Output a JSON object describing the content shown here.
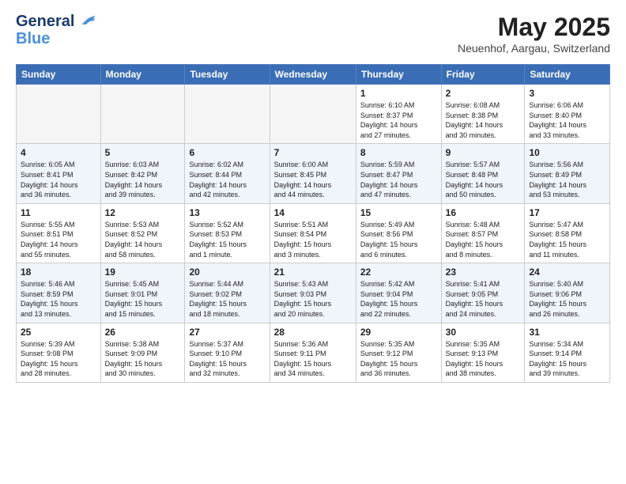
{
  "header": {
    "logo_line1": "General",
    "logo_line2": "Blue",
    "month": "May 2025",
    "location": "Neuenhof, Aargau, Switzerland"
  },
  "weekdays": [
    "Sunday",
    "Monday",
    "Tuesday",
    "Wednesday",
    "Thursday",
    "Friday",
    "Saturday"
  ],
  "weeks": [
    [
      {
        "day": "",
        "info": ""
      },
      {
        "day": "",
        "info": ""
      },
      {
        "day": "",
        "info": ""
      },
      {
        "day": "",
        "info": ""
      },
      {
        "day": "1",
        "info": "Sunrise: 6:10 AM\nSunset: 8:37 PM\nDaylight: 14 hours\nand 27 minutes."
      },
      {
        "day": "2",
        "info": "Sunrise: 6:08 AM\nSunset: 8:38 PM\nDaylight: 14 hours\nand 30 minutes."
      },
      {
        "day": "3",
        "info": "Sunrise: 6:06 AM\nSunset: 8:40 PM\nDaylight: 14 hours\nand 33 minutes."
      }
    ],
    [
      {
        "day": "4",
        "info": "Sunrise: 6:05 AM\nSunset: 8:41 PM\nDaylight: 14 hours\nand 36 minutes."
      },
      {
        "day": "5",
        "info": "Sunrise: 6:03 AM\nSunset: 8:42 PM\nDaylight: 14 hours\nand 39 minutes."
      },
      {
        "day": "6",
        "info": "Sunrise: 6:02 AM\nSunset: 8:44 PM\nDaylight: 14 hours\nand 42 minutes."
      },
      {
        "day": "7",
        "info": "Sunrise: 6:00 AM\nSunset: 8:45 PM\nDaylight: 14 hours\nand 44 minutes."
      },
      {
        "day": "8",
        "info": "Sunrise: 5:59 AM\nSunset: 8:47 PM\nDaylight: 14 hours\nand 47 minutes."
      },
      {
        "day": "9",
        "info": "Sunrise: 5:57 AM\nSunset: 8:48 PM\nDaylight: 14 hours\nand 50 minutes."
      },
      {
        "day": "10",
        "info": "Sunrise: 5:56 AM\nSunset: 8:49 PM\nDaylight: 14 hours\nand 53 minutes."
      }
    ],
    [
      {
        "day": "11",
        "info": "Sunrise: 5:55 AM\nSunset: 8:51 PM\nDaylight: 14 hours\nand 55 minutes."
      },
      {
        "day": "12",
        "info": "Sunrise: 5:53 AM\nSunset: 8:52 PM\nDaylight: 14 hours\nand 58 minutes."
      },
      {
        "day": "13",
        "info": "Sunrise: 5:52 AM\nSunset: 8:53 PM\nDaylight: 15 hours\nand 1 minute."
      },
      {
        "day": "14",
        "info": "Sunrise: 5:51 AM\nSunset: 8:54 PM\nDaylight: 15 hours\nand 3 minutes."
      },
      {
        "day": "15",
        "info": "Sunrise: 5:49 AM\nSunset: 8:56 PM\nDaylight: 15 hours\nand 6 minutes."
      },
      {
        "day": "16",
        "info": "Sunrise: 5:48 AM\nSunset: 8:57 PM\nDaylight: 15 hours\nand 8 minutes."
      },
      {
        "day": "17",
        "info": "Sunrise: 5:47 AM\nSunset: 8:58 PM\nDaylight: 15 hours\nand 11 minutes."
      }
    ],
    [
      {
        "day": "18",
        "info": "Sunrise: 5:46 AM\nSunset: 8:59 PM\nDaylight: 15 hours\nand 13 minutes."
      },
      {
        "day": "19",
        "info": "Sunrise: 5:45 AM\nSunset: 9:01 PM\nDaylight: 15 hours\nand 15 minutes."
      },
      {
        "day": "20",
        "info": "Sunrise: 5:44 AM\nSunset: 9:02 PM\nDaylight: 15 hours\nand 18 minutes."
      },
      {
        "day": "21",
        "info": "Sunrise: 5:43 AM\nSunset: 9:03 PM\nDaylight: 15 hours\nand 20 minutes."
      },
      {
        "day": "22",
        "info": "Sunrise: 5:42 AM\nSunset: 9:04 PM\nDaylight: 15 hours\nand 22 minutes."
      },
      {
        "day": "23",
        "info": "Sunrise: 5:41 AM\nSunset: 9:05 PM\nDaylight: 15 hours\nand 24 minutes."
      },
      {
        "day": "24",
        "info": "Sunrise: 5:40 AM\nSunset: 9:06 PM\nDaylight: 15 hours\nand 26 minutes."
      }
    ],
    [
      {
        "day": "25",
        "info": "Sunrise: 5:39 AM\nSunset: 9:08 PM\nDaylight: 15 hours\nand 28 minutes."
      },
      {
        "day": "26",
        "info": "Sunrise: 5:38 AM\nSunset: 9:09 PM\nDaylight: 15 hours\nand 30 minutes."
      },
      {
        "day": "27",
        "info": "Sunrise: 5:37 AM\nSunset: 9:10 PM\nDaylight: 15 hours\nand 32 minutes."
      },
      {
        "day": "28",
        "info": "Sunrise: 5:36 AM\nSunset: 9:11 PM\nDaylight: 15 hours\nand 34 minutes."
      },
      {
        "day": "29",
        "info": "Sunrise: 5:35 AM\nSunset: 9:12 PM\nDaylight: 15 hours\nand 36 minutes."
      },
      {
        "day": "30",
        "info": "Sunrise: 5:35 AM\nSunset: 9:13 PM\nDaylight: 15 hours\nand 38 minutes."
      },
      {
        "day": "31",
        "info": "Sunrise: 5:34 AM\nSunset: 9:14 PM\nDaylight: 15 hours\nand 39 minutes."
      }
    ]
  ]
}
